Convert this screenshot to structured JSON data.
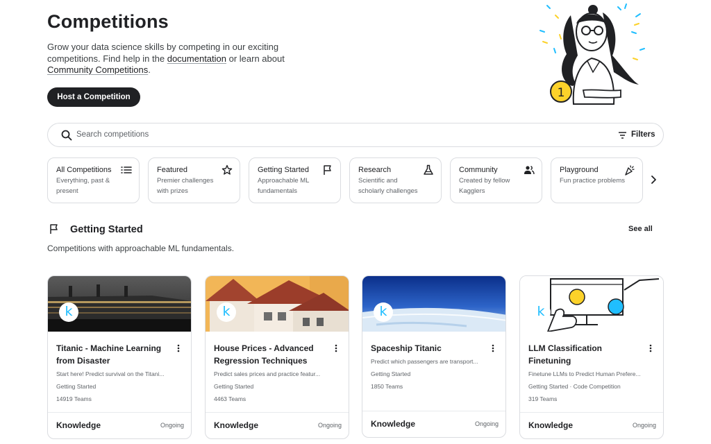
{
  "header": {
    "title": "Competitions",
    "intro_prefix": "Grow your data science skills by competing in our exciting competitions. Find help in the ",
    "documentation_link": "documentation",
    "intro_middle": " or learn about ",
    "community_link": "Community Competitions",
    "intro_suffix": ".",
    "host_button": "Host a Competition"
  },
  "search": {
    "placeholder": "Search competitions",
    "filters_label": "Filters"
  },
  "categories": [
    {
      "title": "All Competitions",
      "description": "Everything, past & present",
      "icon": "list-icon"
    },
    {
      "title": "Featured",
      "description": "Premier challenges with prizes",
      "icon": "star-icon"
    },
    {
      "title": "Getting Started",
      "description": "Approachable ML fundamentals",
      "icon": "flag-icon"
    },
    {
      "title": "Research",
      "description": "Scientific and scholarly challenges",
      "icon": "flask-icon"
    },
    {
      "title": "Community",
      "description": "Created by fellow Kagglers",
      "icon": "people-icon"
    },
    {
      "title": "Playground",
      "description": "Fun practice problems",
      "icon": "party-popper-icon"
    }
  ],
  "section": {
    "title": "Getting Started",
    "see_all": "See all",
    "description": "Competitions with approachable ML fundamentals."
  },
  "cards": [
    {
      "name": "Titanic - Machine Learning from Disaster",
      "description": "Start here! Predict survival on the Titani...",
      "tags": "Getting Started",
      "teams": "14919 Teams",
      "type": "Knowledge",
      "status": "Ongoing"
    },
    {
      "name": "House Prices - Advanced Regression Techniques",
      "description": "Predict sales prices and practice featur...",
      "tags": "Getting Started",
      "teams": "4463 Teams",
      "type": "Knowledge",
      "status": "Ongoing"
    },
    {
      "name": "Spaceship Titanic",
      "description": "Predict which passengers are transport...",
      "tags": "Getting Started",
      "teams": "1850 Teams",
      "type": "Knowledge",
      "status": "Ongoing"
    },
    {
      "name": "LLM Classification Finetuning",
      "description": "Finetune LLMs to Predict Human Prefere...",
      "tags": "Getting Started · Code Competition",
      "teams": "319 Teams",
      "type": "Knowledge",
      "status": "Ongoing"
    }
  ],
  "kaggle_badge": "k",
  "hero_coin_label": "1",
  "colors": {
    "brand": "#20beff",
    "text": "#202124",
    "muted": "#5f6368",
    "border": "#dadce0"
  }
}
